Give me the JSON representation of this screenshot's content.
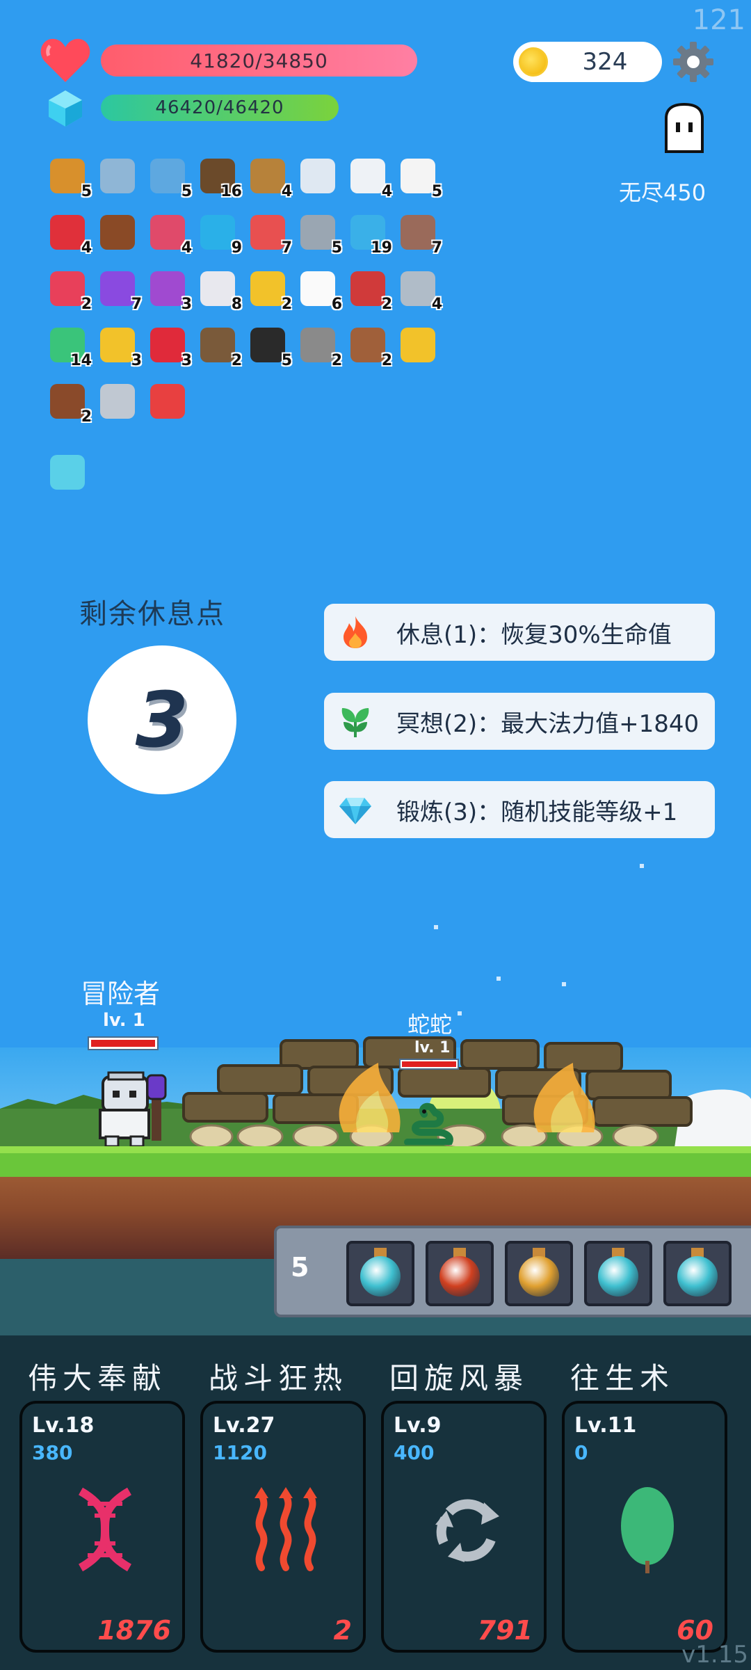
{
  "overlay": {
    "fps": "121",
    "version": "v1.15"
  },
  "stats": {
    "hp_text": "41820/34850",
    "mp_text": "46420/46420",
    "hp_color": "#ff6b84",
    "mp_color": "#4ccc74",
    "coins": "324",
    "endless_label": "无尽450"
  },
  "inventory": [
    {
      "icon": "book-icon",
      "count": "5",
      "color": "#d8902c"
    },
    {
      "icon": "magnifier-icon",
      "count": "",
      "color": "#8fb6d6"
    },
    {
      "icon": "blue-fish-icon",
      "count": "5",
      "color": "#5ea8e0"
    },
    {
      "icon": "coconut-icon",
      "count": "16",
      "color": "#6b4a2a"
    },
    {
      "icon": "bow-icon",
      "count": "4",
      "color": "#b7823a"
    },
    {
      "icon": "atom-ring-icon",
      "count": "",
      "color": "#dfe8f2"
    },
    {
      "icon": "envelope-icon",
      "count": "4",
      "color": "#eef2f6"
    },
    {
      "icon": "dice-icon",
      "count": "5",
      "color": "#f4f4f4"
    },
    {
      "icon": "apple-icon",
      "count": "4",
      "color": "#e0303a"
    },
    {
      "icon": "treasure-chest-icon",
      "count": "",
      "color": "#8a4a26"
    },
    {
      "icon": "jam-jar-icon",
      "count": "4",
      "color": "#e04a6a"
    },
    {
      "icon": "sapphire-icon",
      "count": "9",
      "color": "#2ab0e8"
    },
    {
      "icon": "pill-icon",
      "count": "7",
      "color": "#e85050"
    },
    {
      "icon": "battle-axe-icon",
      "count": "5",
      "color": "#9aa6b2"
    },
    {
      "icon": "speech-bubble-icon",
      "count": "19",
      "color": "#3ab0e8"
    },
    {
      "icon": "tombstone-icon",
      "count": "7",
      "color": "#9a6a5a"
    },
    {
      "icon": "watermelon-icon",
      "count": "2",
      "color": "#e8405a"
    },
    {
      "icon": "star-box-icon",
      "count": "7",
      "color": "#8a4ae0"
    },
    {
      "icon": "crystal-ball-icon",
      "count": "3",
      "color": "#a04ad0"
    },
    {
      "icon": "lightbulb-icon",
      "count": "8",
      "color": "#e8e8ee"
    },
    {
      "icon": "magic-wand-icon",
      "count": "2",
      "color": "#f2c22a"
    },
    {
      "icon": "ghost-icon",
      "count": "6",
      "color": "#fafafa"
    },
    {
      "icon": "shield-icon",
      "count": "2",
      "color": "#d03a3a"
    },
    {
      "icon": "sword-icon",
      "count": "4",
      "color": "#b0bcc8"
    },
    {
      "icon": "potion-flask-icon",
      "count": "14",
      "color": "#3ac47a"
    },
    {
      "icon": "gold-ring-icon",
      "count": "3",
      "color": "#f2c22a"
    },
    {
      "icon": "strawberry-icon",
      "count": "3",
      "color": "#e02a3a"
    },
    {
      "icon": "meteor-icon",
      "count": "2",
      "color": "#7a5a3a"
    },
    {
      "icon": "cauldron-icon",
      "count": "5",
      "color": "#2a2a2a"
    },
    {
      "icon": "spiked-mace-icon",
      "count": "2",
      "color": "#8a8a8a"
    },
    {
      "icon": "round-shield-icon",
      "count": "2",
      "color": "#a0603a"
    },
    {
      "icon": "sunflower-icon",
      "count": "",
      "color": "#f2c22a"
    },
    {
      "icon": "cupcake-icon",
      "count": "2",
      "color": "#8a4a2a"
    },
    {
      "icon": "hook-icon",
      "count": "",
      "color": "#c0c8d2"
    },
    {
      "icon": "double-heart-icon",
      "count": "",
      "color": "#e84040"
    },
    {
      "icon": "light-card-icon",
      "count": "",
      "color": "#5ad0e8"
    }
  ],
  "rest": {
    "title": "剩余休息点",
    "points": "3",
    "actions": [
      {
        "icon": "fire-icon",
        "label": "休息(1)：恢复30%生命值"
      },
      {
        "icon": "sprout-icon",
        "label": "冥想(2)：最大法力值+1840"
      },
      {
        "icon": "diamond-icon",
        "label": "锻炼(3)：随机技能等级+1"
      }
    ]
  },
  "scene": {
    "hero_name": "冒险者",
    "hero_level": "lv. 1",
    "enemy_name": "蛇蛇",
    "enemy_level": "lv. 1"
  },
  "potions": {
    "count": "5",
    "slots": [
      {
        "icon": "cyan-potion-icon",
        "color": "#3fc0d0"
      },
      {
        "icon": "fire-potion-icon",
        "color": "#d04020"
      },
      {
        "icon": "burst-potion-icon",
        "color": "#e0a030"
      },
      {
        "icon": "cyan-potion-icon",
        "color": "#3fc0d0"
      },
      {
        "icon": "cyan-potion-icon",
        "color": "#3fc0d0"
      }
    ]
  },
  "skills": [
    {
      "name": "伟大奉献",
      "level": "Lv.18",
      "power": "380",
      "cost": "1876",
      "icon": "dna-icon",
      "color": "#e8306a"
    },
    {
      "name": "战斗狂热",
      "level": "Lv.27",
      "power": "1120",
      "cost": "2",
      "icon": "heat-waves-icon",
      "color": "#f04a30"
    },
    {
      "name": "回旋风暴",
      "level": "Lv.9",
      "power": "400",
      "cost": "791",
      "icon": "cycle-arrows-icon",
      "color": "#b8c0c8"
    },
    {
      "name": "往生术",
      "level": "Lv.11",
      "power": "0",
      "cost": "60",
      "icon": "leaf-icon",
      "color": "#3cb878"
    }
  ]
}
